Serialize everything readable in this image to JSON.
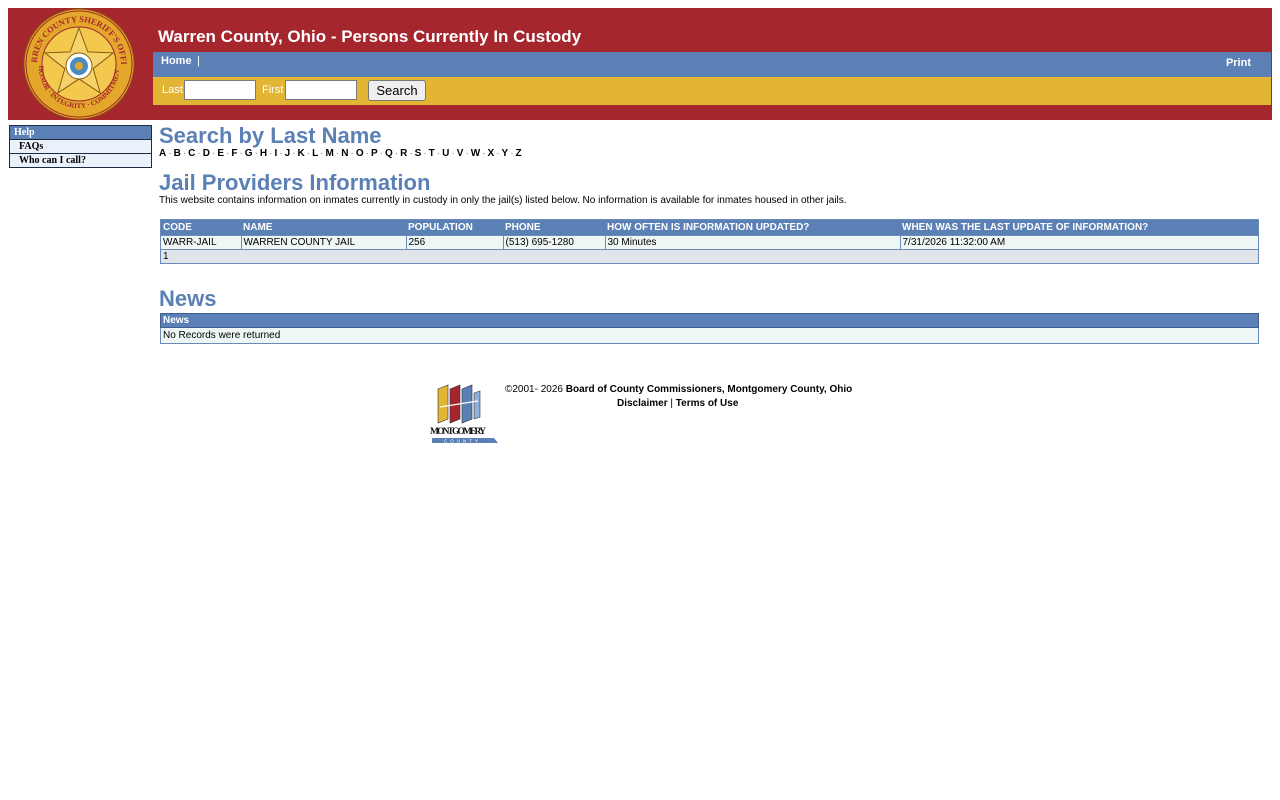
{
  "header": {
    "title": "Warren County, Ohio - Persons Currently In Custody",
    "seal_text": "WARREN COUNTY SHERIFF'S OFFICE · HONOR · INTEGRITY · COMMITMENT"
  },
  "nav": {
    "home": "Home",
    "separator": "|",
    "print": "Print"
  },
  "search": {
    "last_label": "Last",
    "last_value": "",
    "first_label": "First",
    "first_value": "",
    "button": "Search"
  },
  "sidebar": {
    "heading": "Help",
    "items": [
      {
        "label": "FAQs"
      },
      {
        "label": "Who can I call?"
      }
    ]
  },
  "search_by_last_name": {
    "title": "Search by Last Name",
    "letters": [
      "A",
      "B",
      "C",
      "D",
      "E",
      "F",
      "G",
      "H",
      "I",
      "J",
      "K",
      "L",
      "M",
      "N",
      "O",
      "P",
      "Q",
      "R",
      "S",
      "T",
      "U",
      "V",
      "W",
      "X",
      "Y",
      "Z"
    ],
    "separator": "·"
  },
  "jail_providers": {
    "title": "Jail Providers Information",
    "description": "This website contains information on inmates currently in custody in only the jail(s) listed below. No information is available for inmates housed in other jails.",
    "headers": [
      "CODE",
      "NAME",
      "POPULATION",
      "PHONE",
      "HOW OFTEN IS INFORMATION UPDATED?",
      "WHEN WAS THE LAST UPDATE OF INFORMATION?"
    ],
    "rows": [
      [
        "WARR-JAIL",
        "WARREN COUNTY JAIL",
        "256",
        "(513) 695-1280",
        "30 Minutes",
        "7/31/2026 11:32:00 AM"
      ]
    ],
    "pager": "1"
  },
  "news": {
    "title": "News",
    "header": "News",
    "empty_message": "No Records were returned"
  },
  "footer": {
    "copyright_prefix": "©2001- 2026",
    "copyright_org": "Board of County Commissioners, Montgomery County, Ohio",
    "disclaimer": "Disclaimer",
    "link_separator": "|",
    "terms": "Terms of Use",
    "logo_text": "MONTGOMERY",
    "logo_subtext": "COUNTY"
  },
  "colors": {
    "header_red": "#a6262d",
    "nav_blue": "#5b80b5",
    "search_gold": "#e3b535",
    "cell_bg": "#eef6f6"
  }
}
